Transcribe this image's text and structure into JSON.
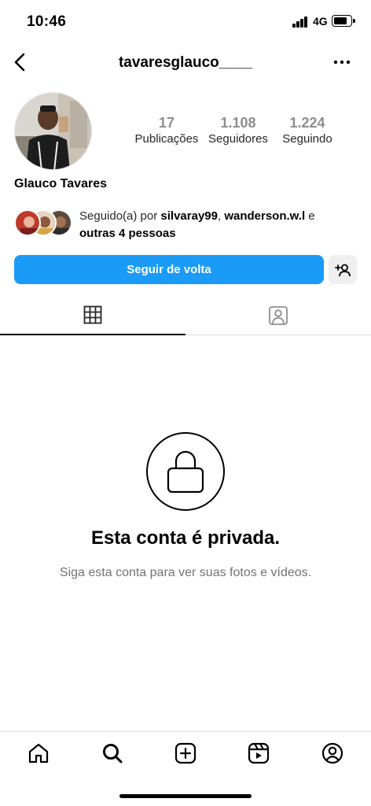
{
  "status_bar": {
    "time": "10:46",
    "network": "4G",
    "battery_level": 0.7
  },
  "header": {
    "username": "tavaresglauco____",
    "back_icon": "chevron-left-icon",
    "more_icon": "more-horizontal-icon"
  },
  "profile": {
    "full_name": "Glauco Tavares",
    "stats": [
      {
        "value": "17",
        "label": "Publicações"
      },
      {
        "value": "1.108",
        "label": "Seguidores"
      },
      {
        "value": "1.224",
        "label": "Seguindo"
      }
    ],
    "followed_by": {
      "prefix": "Seguido(a) por ",
      "user1": "silvaray99",
      "sep": ", ",
      "user2": "wanderson.w.l",
      "conj": " e ",
      "others": "outras 4 pessoas"
    }
  },
  "actions": {
    "follow_label": "Seguir de volta",
    "suggest_icon": "add-person-icon"
  },
  "tabs": [
    {
      "icon": "grid-icon",
      "active": true
    },
    {
      "icon": "tagged-icon",
      "active": false
    }
  ],
  "private": {
    "title": "Esta conta é privada.",
    "subtitle": "Siga esta conta para ver suas fotos e vídeos."
  },
  "bottom_nav": [
    "home-icon",
    "search-icon",
    "create-icon",
    "reels-icon",
    "profile-icon"
  ],
  "colors": {
    "accent": "#1a9bf7",
    "muted_text": "#737373",
    "stat_value": "#8e8e8e"
  }
}
